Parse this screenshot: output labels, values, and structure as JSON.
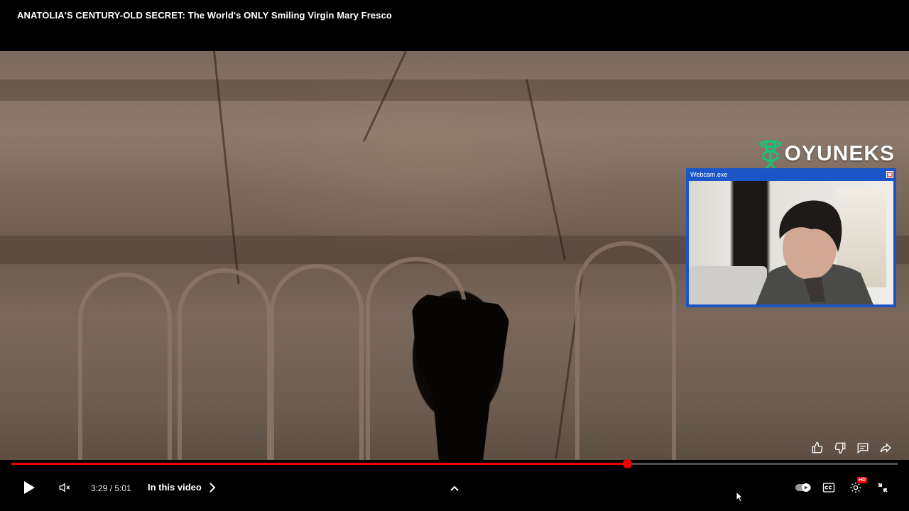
{
  "video": {
    "title": "ANATOLIA'S CENTURY-OLD SECRET: The World's ONLY Smiling Virgin Mary Fresco",
    "overlay_brand": "OYUNEKS",
    "webcam_window_title": "Webcam.exe"
  },
  "player": {
    "current_time": "3:29",
    "separator": " / ",
    "duration": "5:01",
    "progress_fraction": 0.695,
    "chapter_label": "In this video",
    "quality_badge": "HD",
    "accent_color": "#ee0000"
  },
  "icons": {
    "play": "play-icon",
    "mute": "volume-muted-icon",
    "chevron": "chevron-right-icon",
    "expand": "chevron-up-icon",
    "autoplay": "autoplay-toggle-icon",
    "captions": "captions-icon",
    "settings": "gear-icon",
    "exit_fullscreen": "exit-fullscreen-icon",
    "like": "thumbs-up-icon",
    "dislike": "thumbs-down-icon",
    "comments": "comment-icon",
    "share": "share-icon"
  }
}
